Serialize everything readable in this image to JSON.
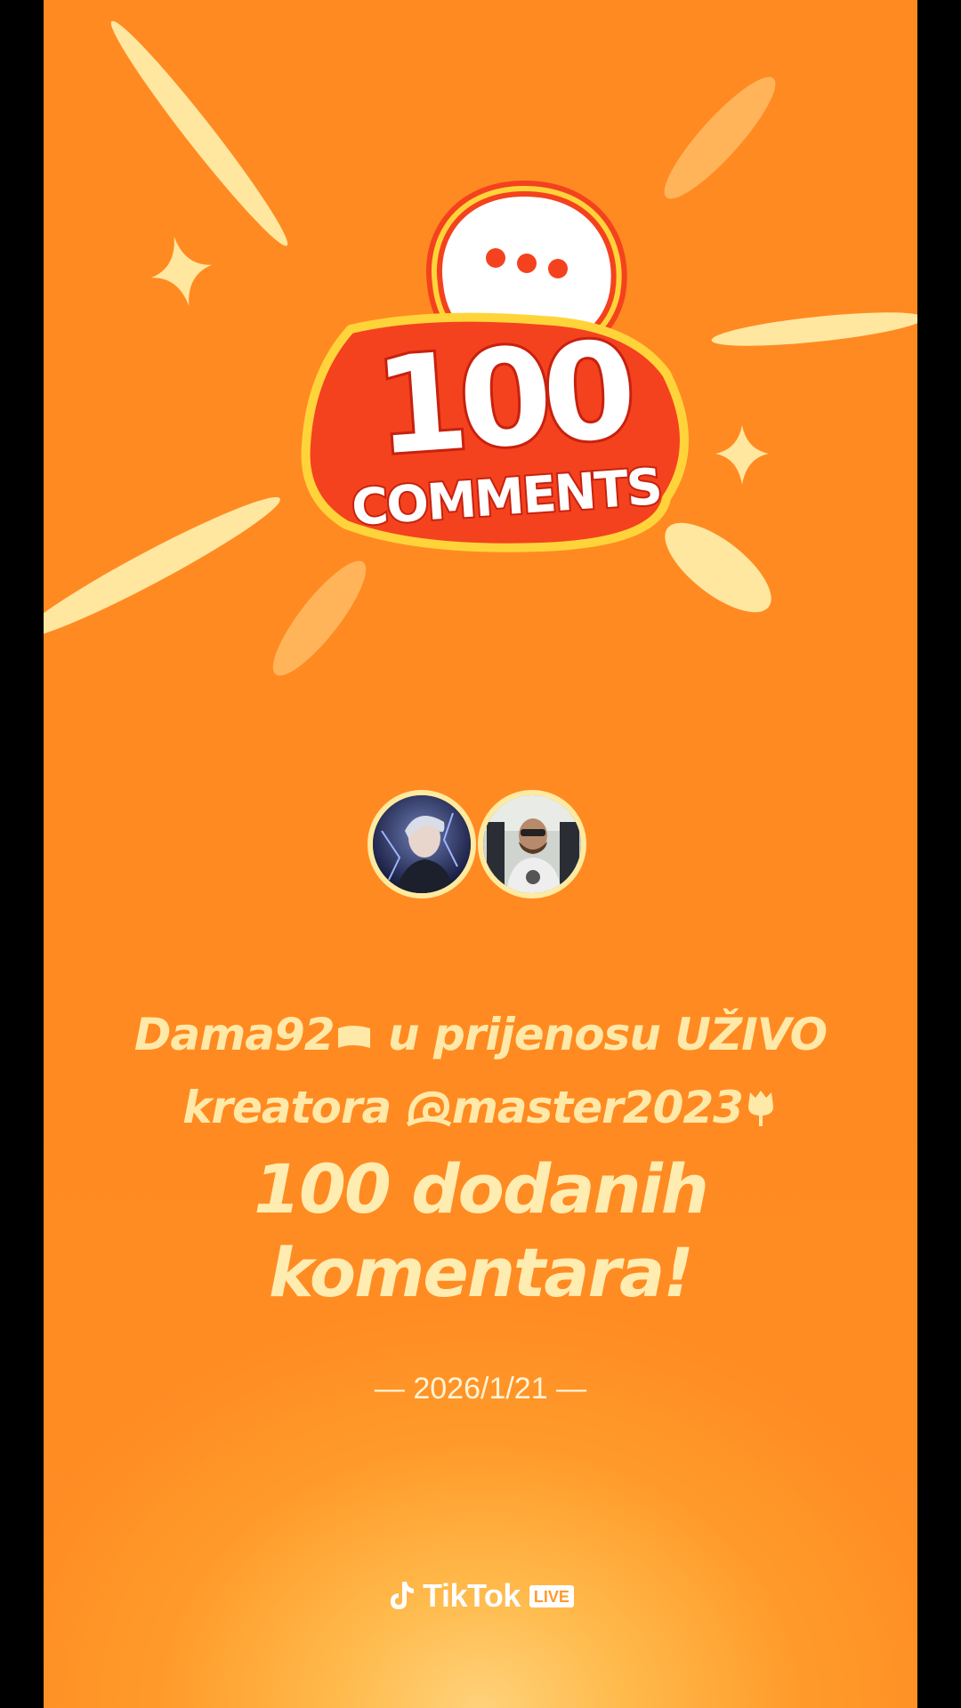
{
  "badge": {
    "number": "100",
    "word": "COMMENTS"
  },
  "creators": {
    "viewer_name": "Dama92",
    "viewer_flag_icon": "white-flag-icon",
    "phrase": "u prijenosu UŽIVO",
    "prefix": "kreatora",
    "creator_name": "master2023",
    "creator_prefix_icon": "dragon-icon",
    "creator_suffix_icon": "rose-icon"
  },
  "milestone": {
    "line1": "100 dodanih",
    "line2": "komentara!"
  },
  "date": "— 2026/1/21 —",
  "brand": {
    "name": "TikTok",
    "live_badge": "LIVE",
    "logo_icon": "tiktok-logo-icon"
  },
  "colors": {
    "background": "#ff8a22",
    "badge_red": "#f4421e",
    "badge_yellow": "#ffd43a",
    "text_cream": "#ffe9a8"
  }
}
